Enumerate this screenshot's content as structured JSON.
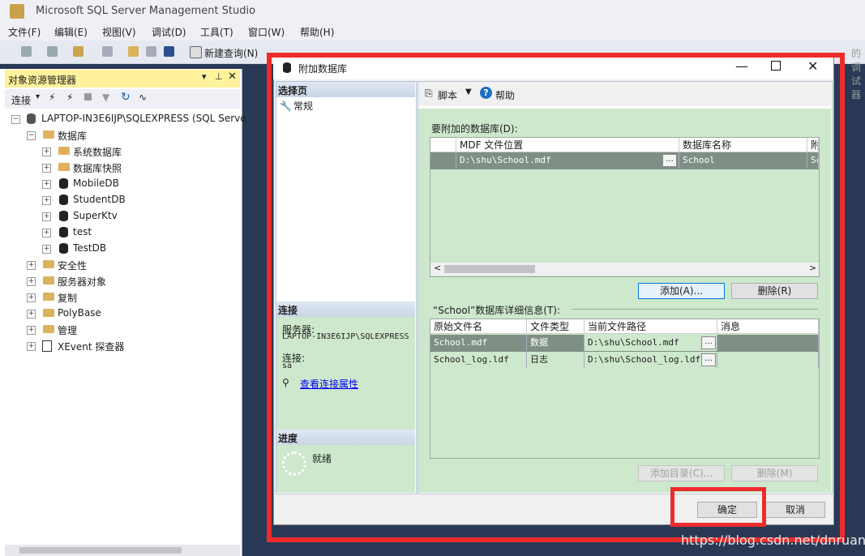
{
  "app": {
    "title": "Microsoft SQL Server Management Studio",
    "menu": [
      "文件(F)",
      "编辑(E)",
      "视图(V)",
      "调试(D)",
      "工具(T)",
      "窗口(W)",
      "帮助(H)"
    ],
    "toolbar_new_query": "新建查询(N)",
    "toolbar_right_text": "的调试器"
  },
  "object_explorer": {
    "title": "对象资源管理器",
    "connect_label": "连接",
    "server": "LAPTOP-IN3E6IJP\\SQLEXPRESS (SQL Serve",
    "nodes": {
      "databases": "数据库",
      "system_db": "系统数据库",
      "db_snapshots": "数据库快照",
      "mobiledb": "MobileDB",
      "studentdb": "StudentDB",
      "superktv": "SuperKtv",
      "test": "test",
      "testdb": "TestDB",
      "security": "安全性",
      "server_objects": "服务器对象",
      "replication": "复制",
      "polybase": "PolyBase",
      "management": "管理",
      "xevent": "XEvent 探查器"
    }
  },
  "dialog": {
    "title": "附加数据库",
    "select_page_header": "选择页",
    "page_general": "常规",
    "connection_header": "连接",
    "server_label": "服务器:",
    "server_value": "LAPTOP-IN3E6IJP\\SQLEXPRESS",
    "connection_label": "连接:",
    "connection_value": "sa",
    "view_conn_props": "查看连接属性",
    "progress_header": "进度",
    "progress_status": "就绪",
    "script_label": "脚本",
    "help_label": "帮助",
    "attach_section_label": "要附加的数据库(D):",
    "attach_grid": {
      "headers": [
        "MDF 文件位置",
        "数据库名称",
        "附"
      ],
      "rows": [
        [
          "D:\\shu\\School.mdf",
          "School",
          "Sc"
        ]
      ]
    },
    "add_button": "添加(A)...",
    "remove_button": "删除(R)",
    "details_label": "“School”数据库详细信息(T):",
    "details_grid": {
      "headers": [
        "原始文件名",
        "文件类型",
        "当前文件路径",
        "消息"
      ],
      "rows": [
        [
          "School.mdf",
          "数据",
          "D:\\shu\\School.mdf",
          ""
        ],
        [
          "School_log.ldf",
          "日志",
          "D:\\shu\\School_log.ldf",
          ""
        ]
      ]
    },
    "add_catalog_button": "添加目录(C)...",
    "remove_details_button": "删除(M)",
    "ok_button": "确定",
    "cancel_button": "取消"
  },
  "watermark": "https://blog.csdn.net/dnruanjian",
  "colors": {
    "highlight": "#ee2b2b",
    "grid_bg": "#cde8cd",
    "selected_row": "#7f8f85",
    "link": "#0000ee"
  }
}
